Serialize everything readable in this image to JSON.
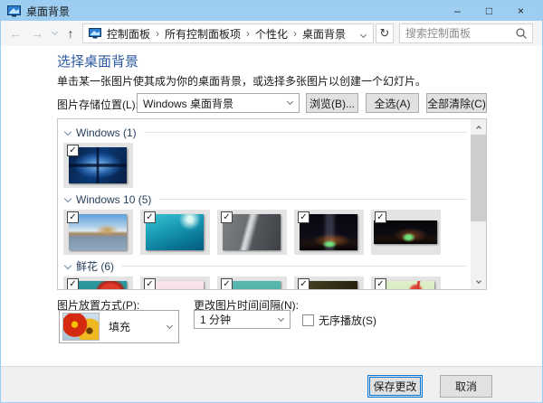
{
  "window": {
    "title": "桌面背景",
    "controls": {
      "minimize": "–",
      "maximize": "□",
      "close": "×"
    }
  },
  "toolbar": {
    "breadcrumb": [
      "控制面板",
      "所有控制面板项",
      "个性化",
      "桌面背景"
    ],
    "breadcrumb_separator": "›",
    "refresh_glyph": "↻",
    "search_placeholder": "搜索控制面板"
  },
  "main": {
    "heading": "选择桌面背景",
    "subtitle": "单击某一张图片使其成为你的桌面背景，或选择多张图片以创建一个幻灯片。",
    "location": {
      "label": "图片存储位置(L):",
      "value": "Windows 桌面背景",
      "browse_label": "浏览(B)...",
      "select_all_label": "全选(A)",
      "clear_all_label": "全部清除(C)"
    },
    "gallery": {
      "check_glyph": "✓",
      "sections": [
        {
          "title": "Windows (1)",
          "items": [
            {
              "name": "windows-hero",
              "checked": true
            }
          ]
        },
        {
          "title": "Windows 10 (5)",
          "items": [
            {
              "name": "beach",
              "checked": true
            },
            {
              "name": "underwater",
              "checked": true
            },
            {
              "name": "cliff",
              "checked": true
            },
            {
              "name": "night-tent",
              "checked": true
            },
            {
              "name": "night-panorama",
              "checked": true,
              "short": true
            }
          ]
        },
        {
          "title": "鲜花 (6)",
          "items": [
            {
              "name": "flower-koi",
              "checked": true
            },
            {
              "name": "flower-petals",
              "checked": true
            },
            {
              "name": "flower-teal",
              "checked": true
            },
            {
              "name": "flower-dark",
              "checked": true
            },
            {
              "name": "flower-poppy",
              "checked": true
            }
          ]
        }
      ]
    },
    "position": {
      "label": "图片放置方式(P):",
      "value": "填充"
    },
    "interval": {
      "label": "更改图片时间间隔(N):",
      "value": "1 分钟"
    },
    "shuffle": {
      "label": "无序播放(S)",
      "checked": false
    }
  },
  "footer": {
    "save_label": "保存更改",
    "cancel_label": "取消"
  },
  "colors": {
    "titlebar": "#9dcdf0",
    "accent": "#0078d7",
    "heading": "#2b5aa0",
    "group_header": "#26415d",
    "tile_selected_bg": "#e4e4e4"
  }
}
